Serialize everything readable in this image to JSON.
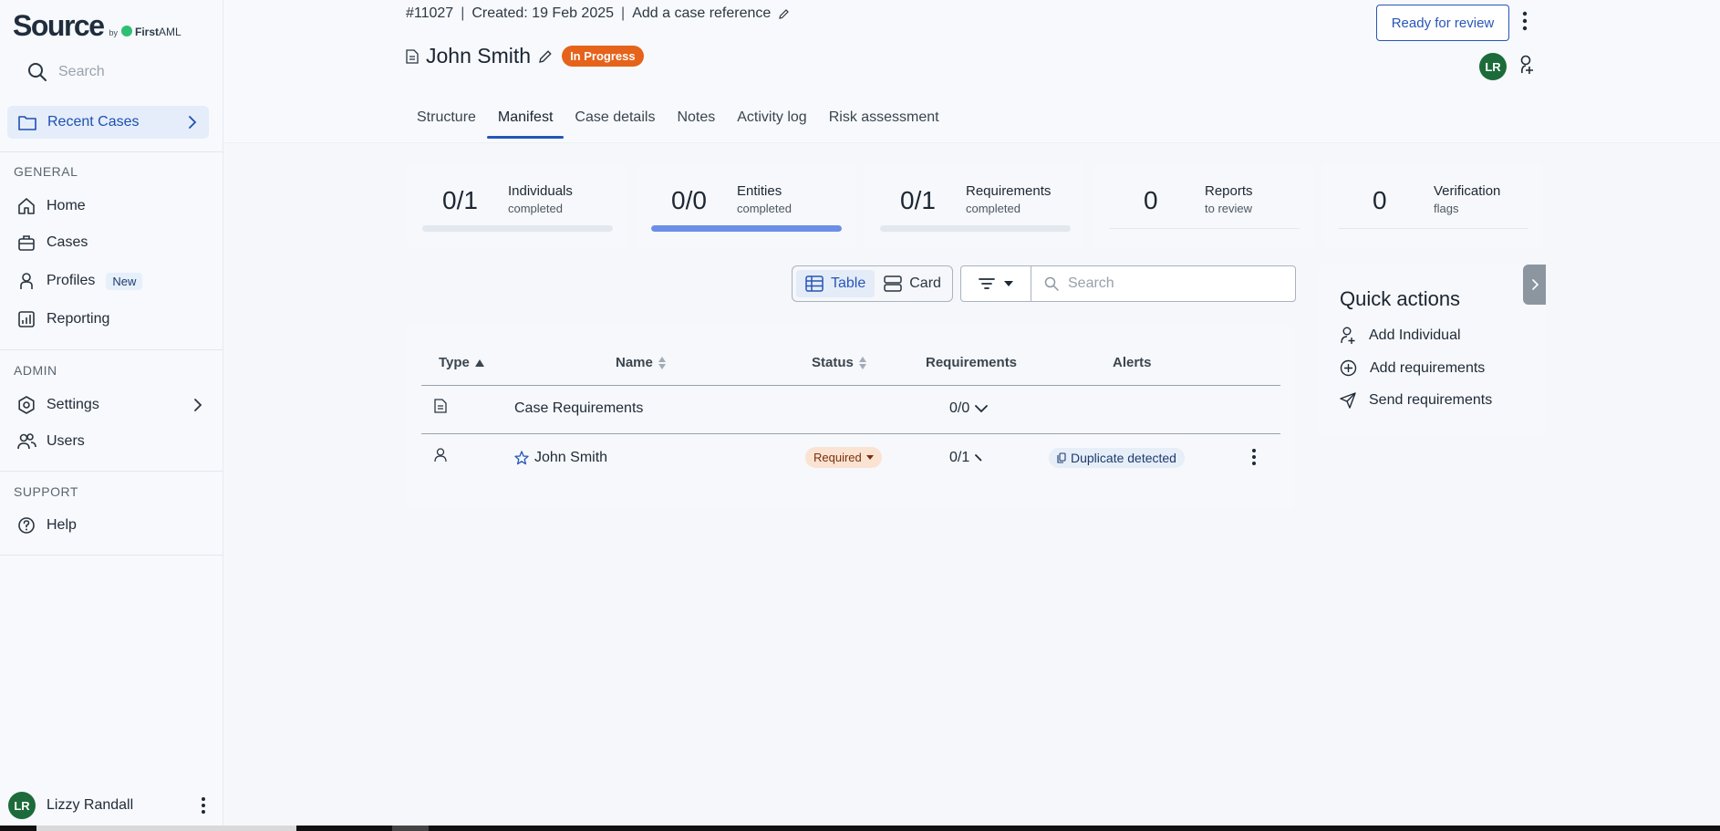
{
  "sidebar": {
    "logo_text": "Source",
    "logo_by": "by",
    "logo_brand_bold": "First",
    "logo_brand_light": "AML",
    "search_placeholder": "Search",
    "recent_cases_label": "Recent Cases",
    "general_title": "GENERAL",
    "general_items": [
      {
        "label": "Home",
        "icon": "home-icon"
      },
      {
        "label": "Cases",
        "icon": "briefcase-icon"
      },
      {
        "label": "Profiles",
        "icon": "person-icon",
        "badge": "New"
      },
      {
        "label": "Reporting",
        "icon": "chart-icon"
      }
    ],
    "admin_title": "ADMIN",
    "admin_items": [
      {
        "label": "Settings",
        "icon": "gear-icon"
      },
      {
        "label": "Users",
        "icon": "users-icon"
      }
    ],
    "support_title": "SUPPORT",
    "support_items": [
      {
        "label": "Help",
        "icon": "help-icon"
      }
    ],
    "user": {
      "initials": "LR",
      "name": "Lizzy Randall"
    }
  },
  "header": {
    "case_id": "#11027",
    "created": "Created: 19 Feb 2025",
    "case_reference_link": "Add a case reference",
    "title": "John Smith",
    "status": "In Progress",
    "ready_button": "Ready for review",
    "avatar_initials": "LR",
    "tabs": [
      {
        "label": "Structure",
        "active": false
      },
      {
        "label": "Manifest",
        "active": true
      },
      {
        "label": "Case details",
        "active": false
      },
      {
        "label": "Notes",
        "active": false
      },
      {
        "label": "Activity log",
        "active": false
      },
      {
        "label": "Risk assessment",
        "active": false
      }
    ]
  },
  "stats": [
    {
      "value": "0/1",
      "label": "Individuals",
      "sub": "completed",
      "progress": 0
    },
    {
      "value": "0/0",
      "label": "Entities",
      "sub": "completed",
      "progress": 1
    },
    {
      "value": "0/1",
      "label": "Requirements",
      "sub": "completed",
      "progress": 0
    },
    {
      "value": "0",
      "label": "Reports",
      "sub": "to review"
    },
    {
      "value": "0",
      "label": "Verification",
      "sub": "flags"
    }
  ],
  "toolbar": {
    "table_label": "Table",
    "card_label": "Card",
    "search_placeholder": "Search"
  },
  "table": {
    "headers": {
      "type": "Type",
      "name": "Name",
      "status": "Status",
      "requirements": "Requirements",
      "alerts": "Alerts"
    },
    "rows": [
      {
        "type_icon": "document-icon",
        "name": "Case Requirements",
        "status": "",
        "requirements": "0/0",
        "alert": ""
      },
      {
        "type_icon": "person-icon",
        "name": "John Smith",
        "status": "Required",
        "requirements": "0/1",
        "alert": "Duplicate detected"
      }
    ]
  },
  "quick_actions": {
    "title": "Quick actions",
    "items": [
      {
        "label": "Add Individual",
        "icon": "person-add-icon"
      },
      {
        "label": "Add requirements",
        "icon": "plus-circle-icon"
      },
      {
        "label": "Send requirements",
        "icon": "send-icon"
      }
    ]
  },
  "colors": {
    "accent": "#2755b8",
    "status_in_progress": "#e5631a",
    "avatar": "#1d6b3a",
    "progress_fill": "#6b8fe6"
  }
}
